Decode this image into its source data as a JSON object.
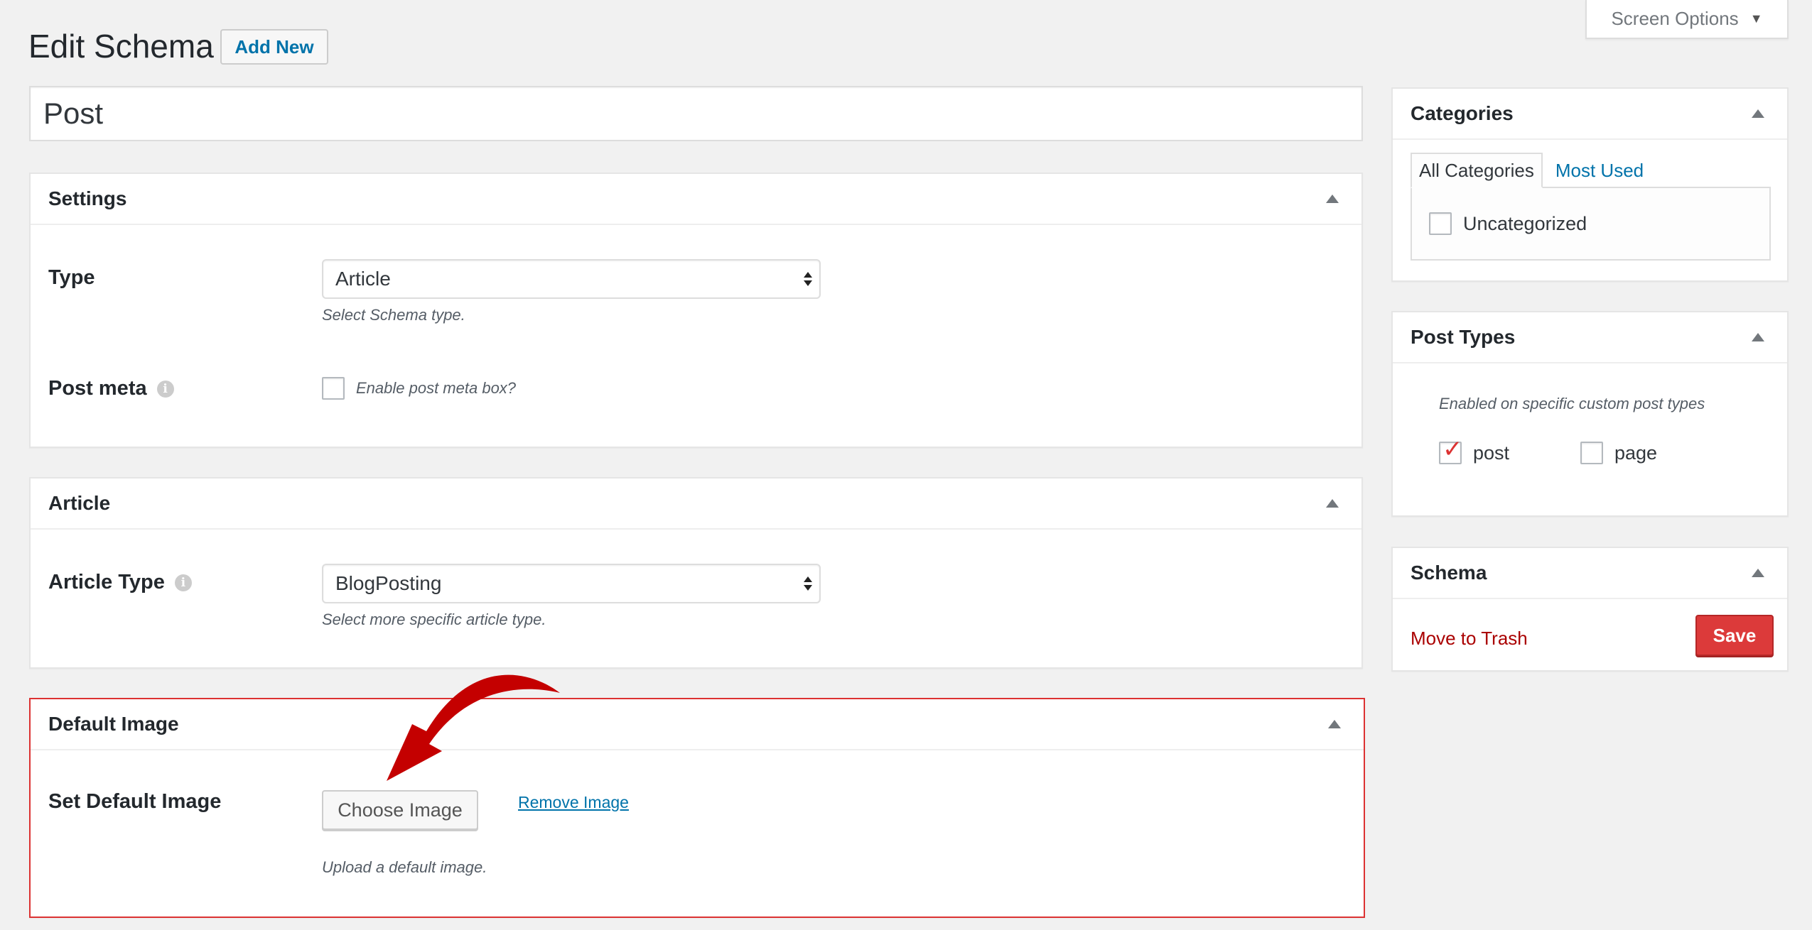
{
  "header": {
    "title": "Edit Schema",
    "add_new_label": "Add New",
    "screen_options_label": "Screen Options"
  },
  "post_title": {
    "value": "Post"
  },
  "settings_box": {
    "title": "Settings",
    "type_label": "Type",
    "type_value": "Article",
    "type_description": "Select Schema type.",
    "post_meta_label": "Post meta",
    "post_meta_checkbox_label": "Enable post meta box?",
    "post_meta_checked": false
  },
  "article_box": {
    "title": "Article",
    "article_type_label": "Article Type",
    "article_type_value": "BlogPosting",
    "article_type_description": "Select more specific article type."
  },
  "default_image_box": {
    "title": "Default Image",
    "set_label": "Set Default Image",
    "choose_button": "Choose Image",
    "remove_link": "Remove Image",
    "description": "Upload a default image."
  },
  "categories_box": {
    "title": "Categories",
    "tabs": [
      "All Categories",
      "Most Used"
    ],
    "items": [
      {
        "label": "Uncategorized",
        "checked": false
      }
    ]
  },
  "post_types_box": {
    "title": "Post Types",
    "description": "Enabled on specific custom post types",
    "items": [
      {
        "label": "post",
        "checked": true
      },
      {
        "label": "page",
        "checked": false
      }
    ]
  },
  "schema_box": {
    "title": "Schema",
    "trash_label": "Move to Trash",
    "save_label": "Save"
  },
  "colors": {
    "link_blue": "#0073aa",
    "trash_red": "#a00",
    "save_red": "#dc3a3a",
    "highlight_border": "#dc3232",
    "arrow_red": "#c40000"
  }
}
